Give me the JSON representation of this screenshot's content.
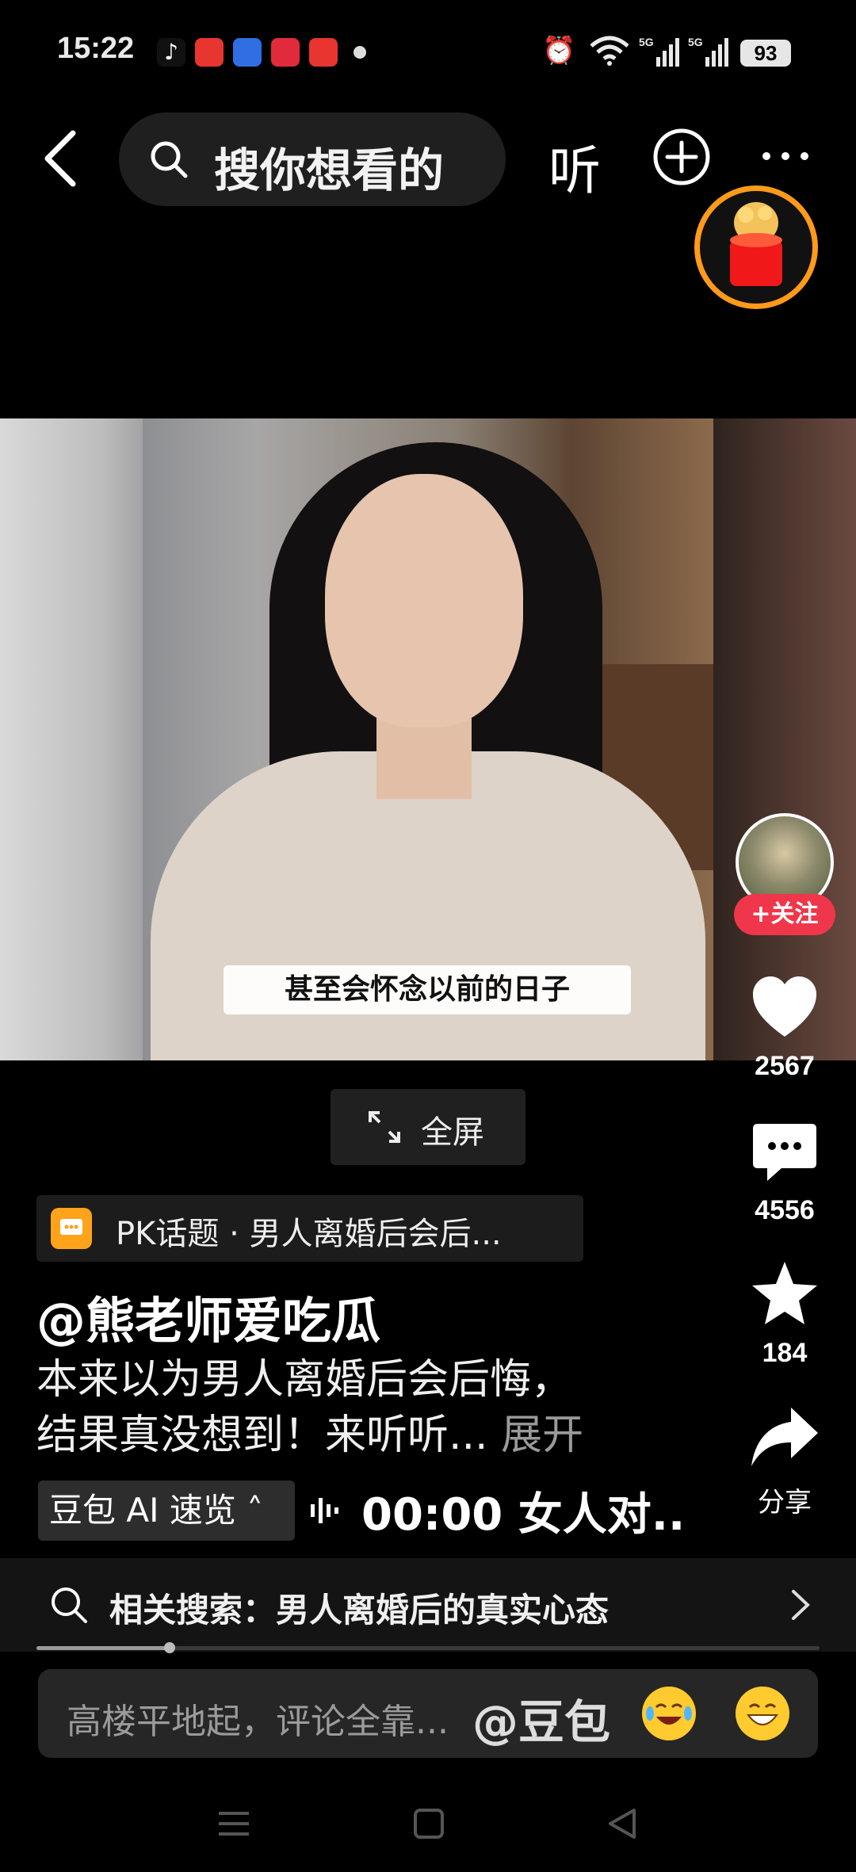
{
  "status_bar": {
    "time": "15:22",
    "battery": "93",
    "icons": [
      "tiktok-icon",
      "toutiao-icon",
      "blue-app-icon",
      "heart-app-icon",
      "toutiao-lite-icon",
      "alarm-icon",
      "wifi-icon",
      "signal-5g-icon",
      "signal-5g-icon"
    ]
  },
  "top_bar": {
    "search_placeholder": "搜你想看的",
    "listen_label": "听"
  },
  "video": {
    "subtitle": "甚至会怀念以前的日子",
    "fullscreen_label": "全屏"
  },
  "sidebar": {
    "follow_label": "+关注",
    "likes": "2567",
    "comments": "4556",
    "favorites": "184",
    "share_label": "分享"
  },
  "info": {
    "pk_topic": "PK话题 · 男人离婚后会后...",
    "author": "@熊老师爱吃瓜",
    "description_line1": "本来以为男人离婚后会后悔，",
    "description_line2": "结果真没想到！来听听...",
    "expand_label": "展开",
    "ai_label": "豆包 AI 速览",
    "audio_text": "00:00 女人对.."
  },
  "related": {
    "label": "相关搜索：男人离婚后的真实心态"
  },
  "playback": {
    "progress_fraction": 0.17
  },
  "comment_bar": {
    "placeholder": "高楼平地起，评论全靠...",
    "mention": "@豆包"
  },
  "colors": {
    "accent_red": "#f0364a",
    "ring_orange": "#ff9a1a",
    "pk_orange": "#ffa31a"
  }
}
